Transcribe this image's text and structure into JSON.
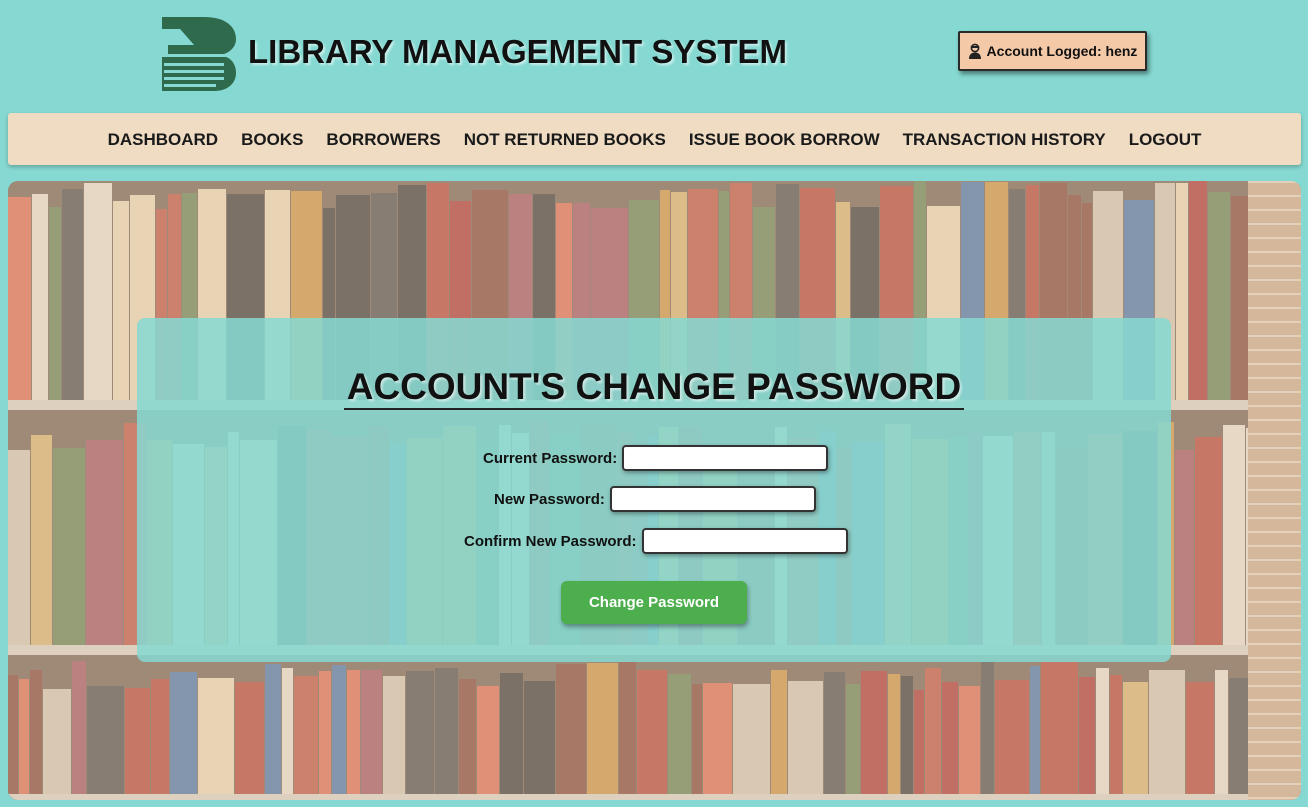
{
  "header": {
    "title": "LIBRARY MANAGEMENT SYSTEM",
    "logo_icon": "book-logo-icon",
    "account_icon": "user-icon",
    "account_text": "Account Logged: henz"
  },
  "nav": {
    "items": [
      {
        "label": "DASHBOARD"
      },
      {
        "label": "BOOKS"
      },
      {
        "label": "BORROWERS"
      },
      {
        "label": "NOT RETURNED BOOKS"
      },
      {
        "label": "ISSUE BOOK BORROW"
      },
      {
        "label": "TRANSACTION HISTORY"
      },
      {
        "label": "LOGOUT"
      }
    ]
  },
  "form": {
    "title": "ACCOUNT'S CHANGE PASSWORD",
    "current_password_label": "Current Password:",
    "current_password_value": "",
    "new_password_label": "New Password:",
    "new_password_value": "",
    "confirm_password_label": "Confirm New Password:",
    "confirm_password_value": "",
    "submit_label": "Change Password"
  },
  "colors": {
    "page_background": "#86d9d2",
    "nav_background": "#efdcc3",
    "account_badge": "#f3c9a8",
    "button": "#4cae4c",
    "logo": "#2e6a4b"
  }
}
